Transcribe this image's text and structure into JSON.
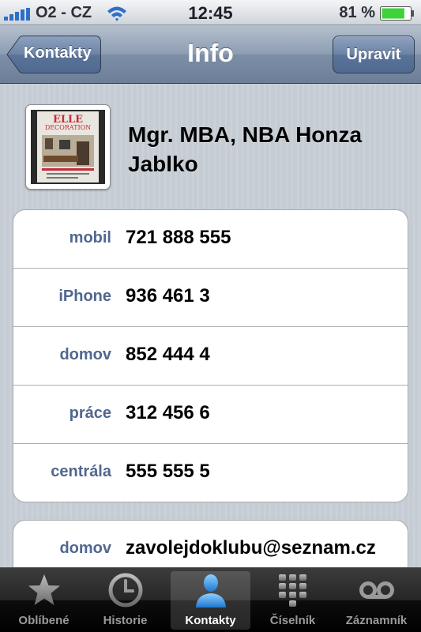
{
  "status_bar": {
    "carrier": "O2 - CZ",
    "time": "12:45",
    "battery_percent": "81 %",
    "battery_level": 0.81,
    "signal_bars": 5
  },
  "nav_bar": {
    "back_label": "Kontakty",
    "title": "Info",
    "edit_label": "Upravit"
  },
  "contact": {
    "name": "Mgr. MBA, NBA Honza Jablko",
    "photo_text": "ELLE DECORATION"
  },
  "phone_numbers": [
    {
      "label": "mobil",
      "value": "721 888 555"
    },
    {
      "label": "iPhone",
      "value": "936 461 3"
    },
    {
      "label": "domov",
      "value": "852 444 4"
    },
    {
      "label": "práce",
      "value": "312 456 6"
    },
    {
      "label": "centrála",
      "value": "555 555 5"
    }
  ],
  "emails": [
    {
      "label": "domov",
      "value": "zavolejdoklubu@seznam.cz"
    }
  ],
  "tab_bar": {
    "tabs": [
      {
        "label": "Oblíbené",
        "icon": "star-icon",
        "active": false
      },
      {
        "label": "Historie",
        "icon": "clock-icon",
        "active": false
      },
      {
        "label": "Kontakty",
        "icon": "person-icon",
        "active": true
      },
      {
        "label": "Číselník",
        "icon": "keypad-icon",
        "active": false
      },
      {
        "label": "Záznamník",
        "icon": "voicemail-icon",
        "active": false
      }
    ]
  },
  "colors": {
    "nav_blue": "#6d7f98",
    "label_blue": "#50678f",
    "active_tab_blue": "#3aa0e8",
    "battery_green": "#3fd23b"
  }
}
